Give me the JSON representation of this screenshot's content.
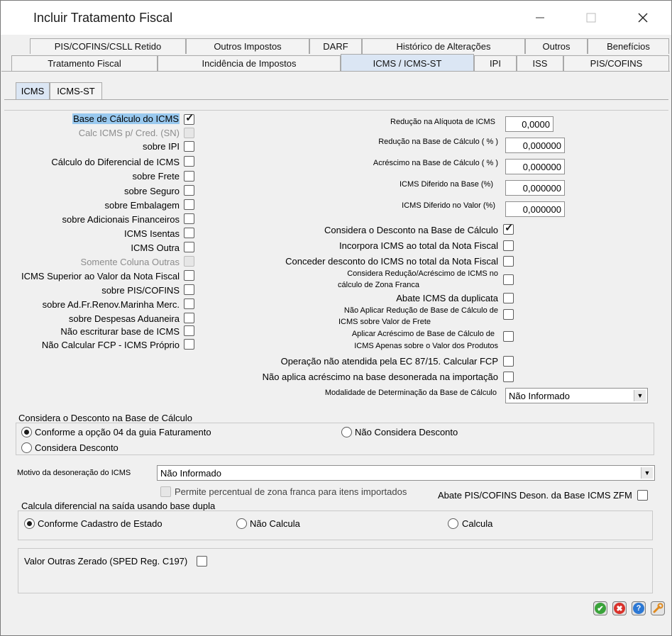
{
  "window": {
    "title": "Incluir Tratamento Fiscal"
  },
  "tabs_row1": [
    "PIS/COFINS/CSLL Retido",
    "Outros Impostos",
    "DARF",
    "Histórico de Alterações",
    "Outros",
    "Benefícios"
  ],
  "tabs_row2": [
    "Tratamento Fiscal",
    "Incidência de Impostos",
    "ICMS / ICMS-ST",
    "IPI",
    "ISS",
    "PIS/COFINS"
  ],
  "subtabs": [
    "ICMS",
    "ICMS-ST"
  ],
  "left_checks": [
    {
      "label": "Base de Cálculo do ICMS",
      "checked": true,
      "enabled": true,
      "selected": true
    },
    {
      "label": "Calc ICMS p/ Cred. (SN)",
      "checked": false,
      "enabled": false
    },
    {
      "label": "sobre IPI",
      "checked": false,
      "enabled": true
    },
    {
      "label": "Cálculo do Diferencial de ICMS",
      "checked": false,
      "enabled": true
    },
    {
      "label": "sobre Frete",
      "checked": false,
      "enabled": true
    },
    {
      "label": "sobre Seguro",
      "checked": false,
      "enabled": true
    },
    {
      "label": "sobre Embalagem",
      "checked": false,
      "enabled": true
    },
    {
      "label": "sobre Adicionais Financeiros",
      "checked": false,
      "enabled": true
    },
    {
      "label": "ICMS Isentas",
      "checked": false,
      "enabled": true
    },
    {
      "label": "ICMS Outra",
      "checked": false,
      "enabled": true
    },
    {
      "label": "Somente Coluna Outras",
      "checked": false,
      "enabled": false
    },
    {
      "label": "ICMS Superior ao Valor da Nota Fiscal",
      "checked": false,
      "enabled": true
    },
    {
      "label": "sobre PIS/COFINS",
      "checked": false,
      "enabled": true
    },
    {
      "label": "sobre Ad.Fr.Renov.Marinha Merc.",
      "checked": false,
      "enabled": true
    },
    {
      "label": "sobre Despesas Aduaneira",
      "checked": false,
      "enabled": true
    },
    {
      "label": "Não escriturar base de ICMS",
      "checked": false,
      "enabled": true
    },
    {
      "label": "Não Calcular FCP - ICMS Próprio",
      "checked": false,
      "enabled": true
    }
  ],
  "right_fields": [
    {
      "label": "Redução na Alíquota de ICMS",
      "value": "0,0000"
    },
    {
      "label": "Redução na Base de Cálculo ( % )",
      "value": "0,000000"
    },
    {
      "label": "Acréscimo na Base de Cálculo ( % )",
      "value": "0,000000"
    },
    {
      "label": "ICMS Diferido na Base (%)",
      "value": "0,000000"
    },
    {
      "label": "ICMS Diferido no Valor (%)",
      "value": "0,000000"
    }
  ],
  "right_checks": [
    {
      "label": "Considera o Desconto na Base de Cálculo",
      "checked": true
    },
    {
      "label": "Incorpora ICMS ao total da Nota Fiscal",
      "checked": false
    },
    {
      "label": "Conceder desconto do ICMS no total da Nota Fiscal",
      "checked": false
    },
    {
      "label": "Considera Redução/Acréscimo de ICMS no",
      "label2": "cálculo de Zona Franca",
      "checked": false
    },
    {
      "label": "Abate ICMS da duplicata",
      "checked": false
    },
    {
      "label": "Não Aplicar Redução de Base de Cálculo de",
      "label2": "ICMS sobre Valor de Frete",
      "checked": false
    },
    {
      "label": "Aplicar Acréscimo de Base de Cálculo de",
      "label2": "ICMS Apenas sobre o Valor dos Produtos",
      "checked": false
    },
    {
      "label": "Operação não atendida pela EC 87/15. Calcular FCP",
      "checked": false
    },
    {
      "label": "Não aplica acréscimo na base desonerada na importação",
      "checked": false
    }
  ],
  "modalidade": {
    "label": "Modalidade de Determinação da Base de Cálculo",
    "value": "Não Informado"
  },
  "desconto_group": {
    "title": "Considera o Desconto na Base de Cálculo",
    "options": [
      "Conforme a opção 04 da guia Faturamento",
      "Não Considera Desconto",
      "Considera Desconto"
    ],
    "selected": 0
  },
  "motivo": {
    "label": "Motivo da desoneração do ICMS",
    "value": "Não Informado"
  },
  "zona_franca": {
    "label": "Permite percentual de zona franca para itens importados",
    "checked": false,
    "enabled": false
  },
  "abate_pis": {
    "label": "Abate PIS/COFINS Deson. da Base ICMS ZFM",
    "checked": false
  },
  "diferencial_group": {
    "title": "Calcula diferencial na saída usando base dupla",
    "options": [
      "Conforme Cadastro de Estado",
      "Não Calcula",
      "Calcula"
    ],
    "selected": 0
  },
  "valor_outras": {
    "label": "Valor Outras Zerado (SPED Reg. C197)",
    "checked": false
  },
  "footer_icons": [
    "confirm-icon",
    "cancel-icon",
    "help-icon",
    "tools-icon"
  ],
  "colors": {
    "ok": "#3aa33a",
    "cancel": "#d9322b",
    "help": "#2c78d4",
    "tools": "#e08a1e",
    "active_tab": "#dbe6f4"
  }
}
